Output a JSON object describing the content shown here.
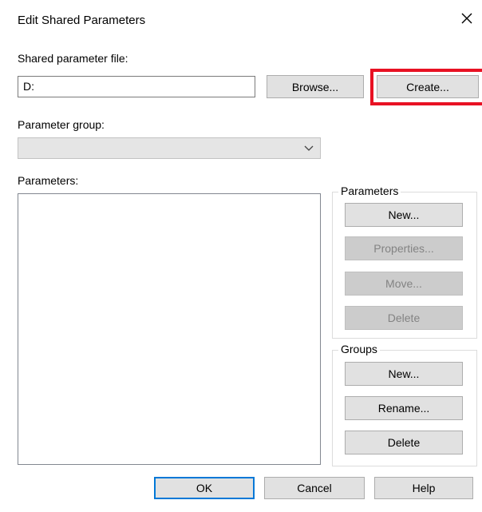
{
  "dialog": {
    "title": "Edit Shared Parameters",
    "close_icon": "close-icon"
  },
  "shared_file": {
    "label": "Shared parameter file:",
    "value": "D:",
    "browse_label": "Browse...",
    "create_label": "Create...",
    "highlight_color": "#e81123"
  },
  "param_group": {
    "label": "Parameter group:",
    "selected_value": "",
    "dropdown_icon": "chevron-down-icon"
  },
  "parameters_list": {
    "label": "Parameters:",
    "items": []
  },
  "parameters_box": {
    "legend": "Parameters",
    "new_label": "New...",
    "properties_label": "Properties...",
    "move_label": "Move...",
    "delete_label": "Delete"
  },
  "groups_box": {
    "legend": "Groups",
    "new_label": "New...",
    "rename_label": "Rename...",
    "delete_label": "Delete"
  },
  "footer": {
    "ok_label": "OK",
    "cancel_label": "Cancel",
    "help_label": "Help",
    "focus_color": "#0078d7"
  }
}
